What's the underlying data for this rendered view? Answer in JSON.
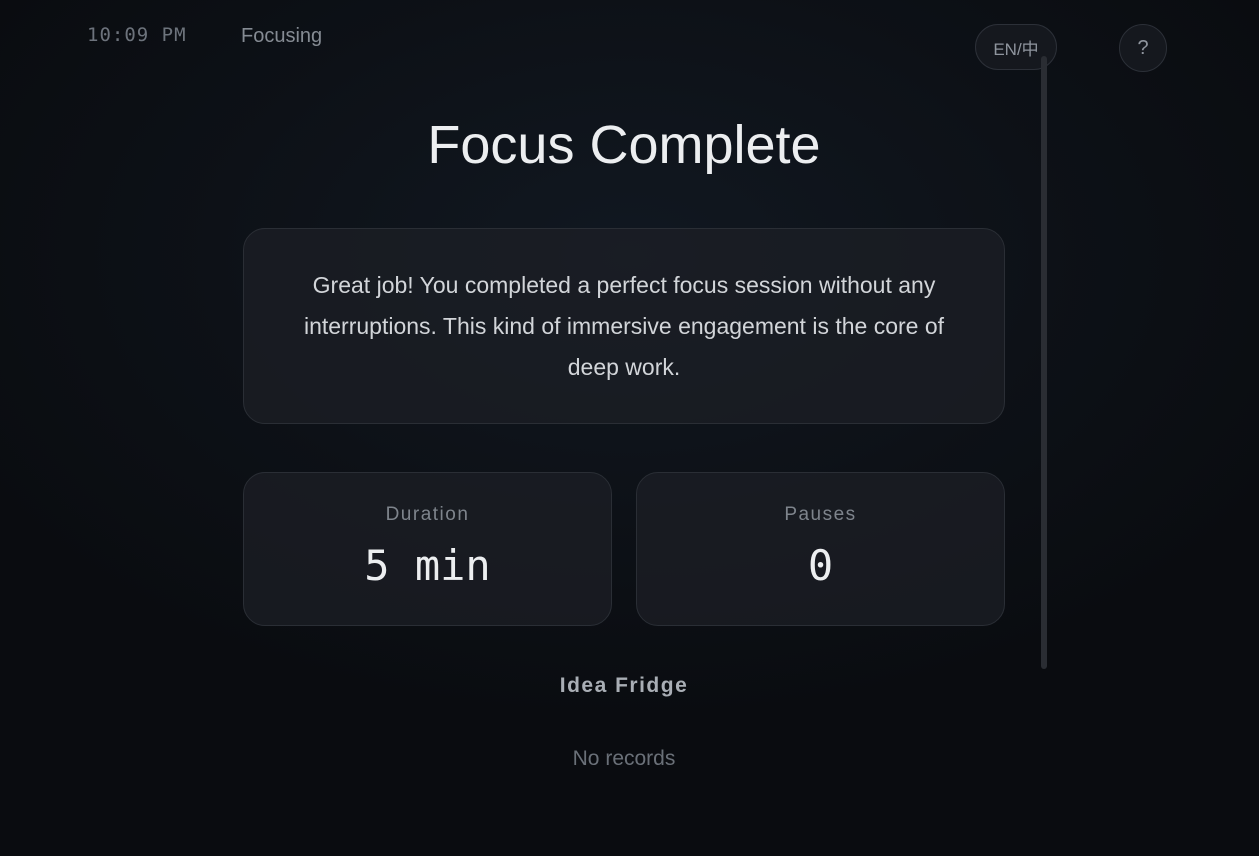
{
  "topbar": {
    "clock": "10:09 PM",
    "status": "Focusing",
    "lang_toggle": "EN/中",
    "help": "?"
  },
  "main": {
    "title": "Focus Complete",
    "message": "Great job! You completed a perfect focus session without any interruptions. This kind of immersive engagement is the core of deep work.",
    "stats": [
      {
        "label": "Duration",
        "value": "5 min"
      },
      {
        "label": "Pauses",
        "value": "0"
      }
    ],
    "idea_fridge": {
      "title": "Idea Fridge",
      "empty_text": "No records"
    }
  },
  "colors": {
    "background": "#0d1117",
    "card": "#1c1f25",
    "text_primary": "#eceef0",
    "text_muted": "#7e848c"
  }
}
